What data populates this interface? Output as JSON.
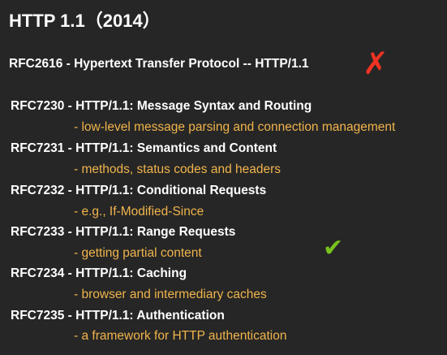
{
  "title": "HTTP 1.1（2014）",
  "obsolete": {
    "label": "RFC2616 - Hypertext Transfer Protocol -- HTTP/1.1",
    "mark": "✗",
    "mark_icon": "cross-icon",
    "mark_color": "#ee3322"
  },
  "rfcs": [
    {
      "title": "RFC7230 - HTTP/1.1: Message Syntax and Routing",
      "desc": "- low-level message parsing and connection management"
    },
    {
      "title": "RFC7231 - HTTP/1.1: Semantics and Content",
      "desc": "- methods, status codes and headers"
    },
    {
      "title": "RFC7232 - HTTP/1.1: Conditional Requests",
      "desc": "- e.g., If-Modified-Since"
    },
    {
      "title": "RFC7233 - HTTP/1.1: Range Requests",
      "desc": "- getting partial content"
    },
    {
      "title": "RFC7234 - HTTP/1.1: Caching",
      "desc": "- browser and intermediary caches"
    },
    {
      "title": "RFC7235 - HTTP/1.1: Authentication",
      "desc": "- a framework for HTTP authentication"
    }
  ],
  "check": {
    "mark": "✔",
    "mark_icon": "checkmark-icon",
    "mark_color": "#77c21c"
  },
  "colors": {
    "background": "#262626",
    "title_text": "#ffffff",
    "description_text": "#f0b44c"
  }
}
